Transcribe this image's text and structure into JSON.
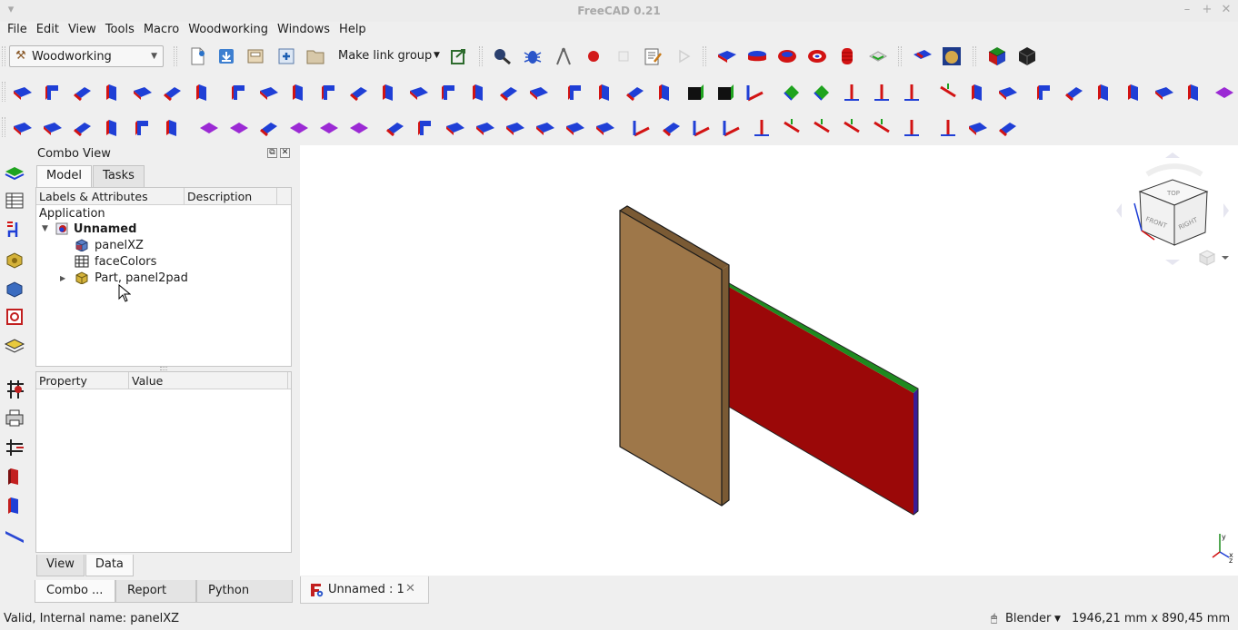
{
  "window": {
    "title": "FreeCAD 0.21",
    "minimize": "–",
    "maximize": "+",
    "close": "✕",
    "menu_glyph": "▾"
  },
  "menubar": {
    "items": [
      "File",
      "Edit",
      "View",
      "Tools",
      "Macro",
      "Woodworking",
      "Windows",
      "Help"
    ]
  },
  "toolbar": {
    "workbench": "Woodworking",
    "link_group_label": "Make link group",
    "icons_row1": [
      "new-file",
      "open-file",
      "save-file",
      "folder",
      "add-link",
      "folder-plain",
      "export-arrow",
      "magnifier",
      "bug",
      "compass",
      "record-macro",
      "stop-macro",
      "edit-macro",
      "play-macro",
      "panel-a",
      "panel-b",
      "panel-c",
      "panel-d",
      "panel-e",
      "panel-f",
      "sketch-blue",
      "sketch-gold",
      "cube-color",
      "cube-black"
    ]
  },
  "combo_view": {
    "title": "Combo View",
    "tabs": [
      "Model",
      "Tasks"
    ],
    "active_tab": "Model",
    "tree_headers": [
      "Labels & Attributes",
      "Description"
    ],
    "tree": {
      "root": "Application",
      "document": "Unnamed",
      "items": [
        {
          "label": "panelXZ",
          "icon": "panel-icon"
        },
        {
          "label": "faceColors",
          "icon": "spreadsheet-icon"
        },
        {
          "label": "Part, panel2pad",
          "icon": "part-icon"
        }
      ]
    },
    "prop_headers": [
      "Property",
      "Value"
    ],
    "prop_tabs": [
      "View",
      "Data"
    ],
    "active_prop_tab": "Data"
  },
  "bottom_tabs": [
    "Combo ...",
    "Report v...",
    "Python con..."
  ],
  "doc_tab": {
    "label": "Unnamed : 1"
  },
  "viewport": {
    "colors": {
      "board_front": "#9e7749",
      "board_side": "#7a5a34",
      "panel_face": "#9b0808",
      "panel_top": "#1f8a1f",
      "panel_edge": "#3a1c96"
    }
  },
  "navcube": {
    "faces": [
      "FRONT",
      "RIGHT",
      "TOP"
    ]
  },
  "status": {
    "left": "Valid, Internal name: panelXZ",
    "nav_style": "Blender",
    "dimensions": "1946,21 mm x 890,45 mm"
  }
}
